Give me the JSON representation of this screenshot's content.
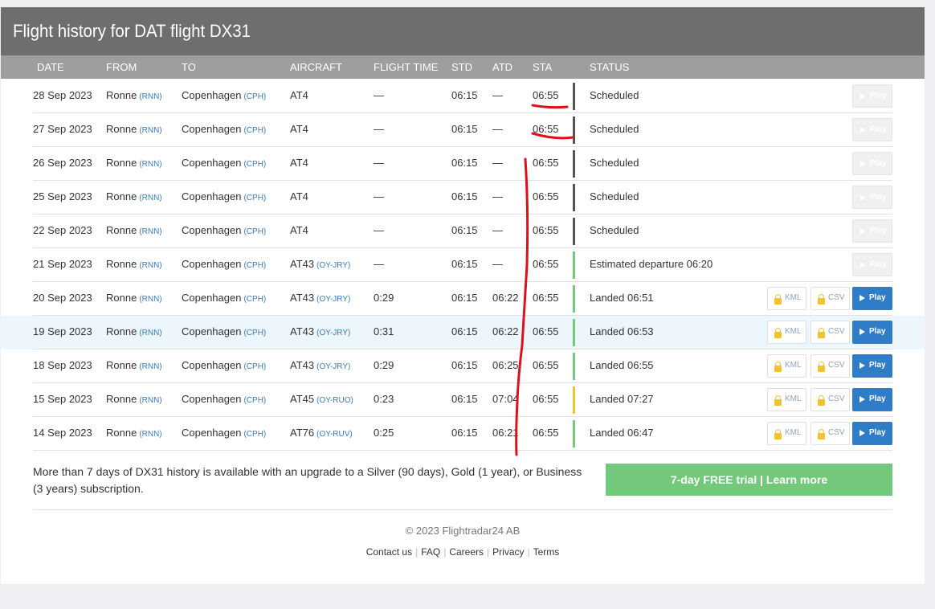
{
  "title": "Flight history for DAT flight DX31",
  "columns": [
    "DATE",
    "FROM",
    "TO",
    "AIRCRAFT",
    "FLIGHT TIME",
    "STD",
    "ATD",
    "STA",
    "STATUS"
  ],
  "rows": [
    {
      "date": "28 Sep 2023",
      "from": "Ronne",
      "from_code": "(RNN)",
      "to": "Copenhagen",
      "to_code": "(CPH)",
      "aircraft": "AT4",
      "reg": "",
      "flight_time": "—",
      "std": "06:15",
      "atd": "—",
      "sta": "06:55",
      "status": "Scheduled",
      "status_color": "#555555",
      "play_label": "Play",
      "play_enabled": false,
      "kml_label": "",
      "csv_label": ""
    },
    {
      "date": "27 Sep 2023",
      "from": "Ronne",
      "from_code": "(RNN)",
      "to": "Copenhagen",
      "to_code": "(CPH)",
      "aircraft": "AT4",
      "reg": "",
      "flight_time": "—",
      "std": "06:15",
      "atd": "—",
      "sta": "06:55",
      "status": "Scheduled",
      "status_color": "#555555",
      "play_label": "Play",
      "play_enabled": false,
      "kml_label": "",
      "csv_label": ""
    },
    {
      "date": "26 Sep 2023",
      "from": "Ronne",
      "from_code": "(RNN)",
      "to": "Copenhagen",
      "to_code": "(CPH)",
      "aircraft": "AT4",
      "reg": "",
      "flight_time": "—",
      "std": "06:15",
      "atd": "—",
      "sta": "06:55",
      "status": "Scheduled",
      "status_color": "#555555",
      "play_label": "Play",
      "play_enabled": false,
      "kml_label": "",
      "csv_label": ""
    },
    {
      "date": "25 Sep 2023",
      "from": "Ronne",
      "from_code": "(RNN)",
      "to": "Copenhagen",
      "to_code": "(CPH)",
      "aircraft": "AT4",
      "reg": "",
      "flight_time": "—",
      "std": "06:15",
      "atd": "—",
      "sta": "06:55",
      "status": "Scheduled",
      "status_color": "#555555",
      "play_label": "Play",
      "play_enabled": false,
      "kml_label": "",
      "csv_label": ""
    },
    {
      "date": "22 Sep 2023",
      "from": "Ronne",
      "from_code": "(RNN)",
      "to": "Copenhagen",
      "to_code": "(CPH)",
      "aircraft": "AT4",
      "reg": "",
      "flight_time": "—",
      "std": "06:15",
      "atd": "—",
      "sta": "06:55",
      "status": "Scheduled",
      "status_color": "#555555",
      "play_label": "Play",
      "play_enabled": false,
      "kml_label": "",
      "csv_label": ""
    },
    {
      "date": "21 Sep 2023",
      "from": "Ronne",
      "from_code": "(RNN)",
      "to": "Copenhagen",
      "to_code": "(CPH)",
      "aircraft": "AT43",
      "reg": "(OY-JRY)",
      "flight_time": "—",
      "std": "06:15",
      "atd": "—",
      "sta": "06:55",
      "status": "Estimated departure 06:20",
      "status_color": "#72c97b",
      "play_label": "Play",
      "play_enabled": false,
      "kml_label": "",
      "csv_label": ""
    },
    {
      "date": "20 Sep 2023",
      "from": "Ronne",
      "from_code": "(RNN)",
      "to": "Copenhagen",
      "to_code": "(CPH)",
      "aircraft": "AT43",
      "reg": "(OY-JRY)",
      "flight_time": "0:29",
      "std": "06:15",
      "atd": "06:22",
      "sta": "06:55",
      "status": "Landed 06:51",
      "status_color": "#72c97b",
      "play_label": "Play",
      "play_enabled": true,
      "kml_label": "KML",
      "csv_label": "CSV"
    },
    {
      "date": "19 Sep 2023",
      "from": "Ronne",
      "from_code": "(RNN)",
      "to": "Copenhagen",
      "to_code": "(CPH)",
      "aircraft": "AT43",
      "reg": "(OY-JRY)",
      "flight_time": "0:31",
      "std": "06:15",
      "atd": "06:22",
      "sta": "06:55",
      "status": "Landed 06:53",
      "status_color": "#72c97b",
      "play_label": "Play",
      "play_enabled": true,
      "kml_label": "KML",
      "csv_label": "CSV",
      "highlighted": true
    },
    {
      "date": "18 Sep 2023",
      "from": "Ronne",
      "from_code": "(RNN)",
      "to": "Copenhagen",
      "to_code": "(CPH)",
      "aircraft": "AT43",
      "reg": "(OY-JRY)",
      "flight_time": "0:29",
      "std": "06:15",
      "atd": "06:25",
      "sta": "06:55",
      "status": "Landed 06:55",
      "status_color": "#72c97b",
      "play_label": "Play",
      "play_enabled": true,
      "kml_label": "KML",
      "csv_label": "CSV"
    },
    {
      "date": "15 Sep 2023",
      "from": "Ronne",
      "from_code": "(RNN)",
      "to": "Copenhagen",
      "to_code": "(CPH)",
      "aircraft": "AT45",
      "reg": "(OY-RUO)",
      "flight_time": "0:23",
      "std": "06:15",
      "atd": "07:04",
      "sta": "06:55",
      "status": "Landed 07:27",
      "status_color": "#f2c230",
      "play_label": "Play",
      "play_enabled": true,
      "kml_label": "KML",
      "csv_label": "CSV"
    },
    {
      "date": "14 Sep 2023",
      "from": "Ronne",
      "from_code": "(RNN)",
      "to": "Copenhagen",
      "to_code": "(CPH)",
      "aircraft": "AT76",
      "reg": "(OY-RUV)",
      "flight_time": "0:25",
      "std": "06:15",
      "atd": "06:21",
      "sta": "06:55",
      "status": "Landed 06:47",
      "status_color": "#72c97b",
      "play_label": "Play",
      "play_enabled": true,
      "kml_label": "KML",
      "csv_label": "CSV"
    }
  ],
  "upgrade_text": "More than 7 days of DX31 history is available with an upgrade to a Silver (90 days), Gold (1 year), or Business (3 years) subscription.",
  "trial_button": "7-day FREE trial | Learn more",
  "copyright": "© 2023 Flightradar24 AB",
  "footer_links": [
    "Contact us",
    "FAQ",
    "Careers",
    "Privacy",
    "Terms"
  ],
  "colors": {
    "title_bar": "#6e6e6e",
    "header_row": "#9e9e9e",
    "play_button": "#2f7dc8",
    "trial_button": "#72c97b",
    "annotation": "#e0101a"
  }
}
